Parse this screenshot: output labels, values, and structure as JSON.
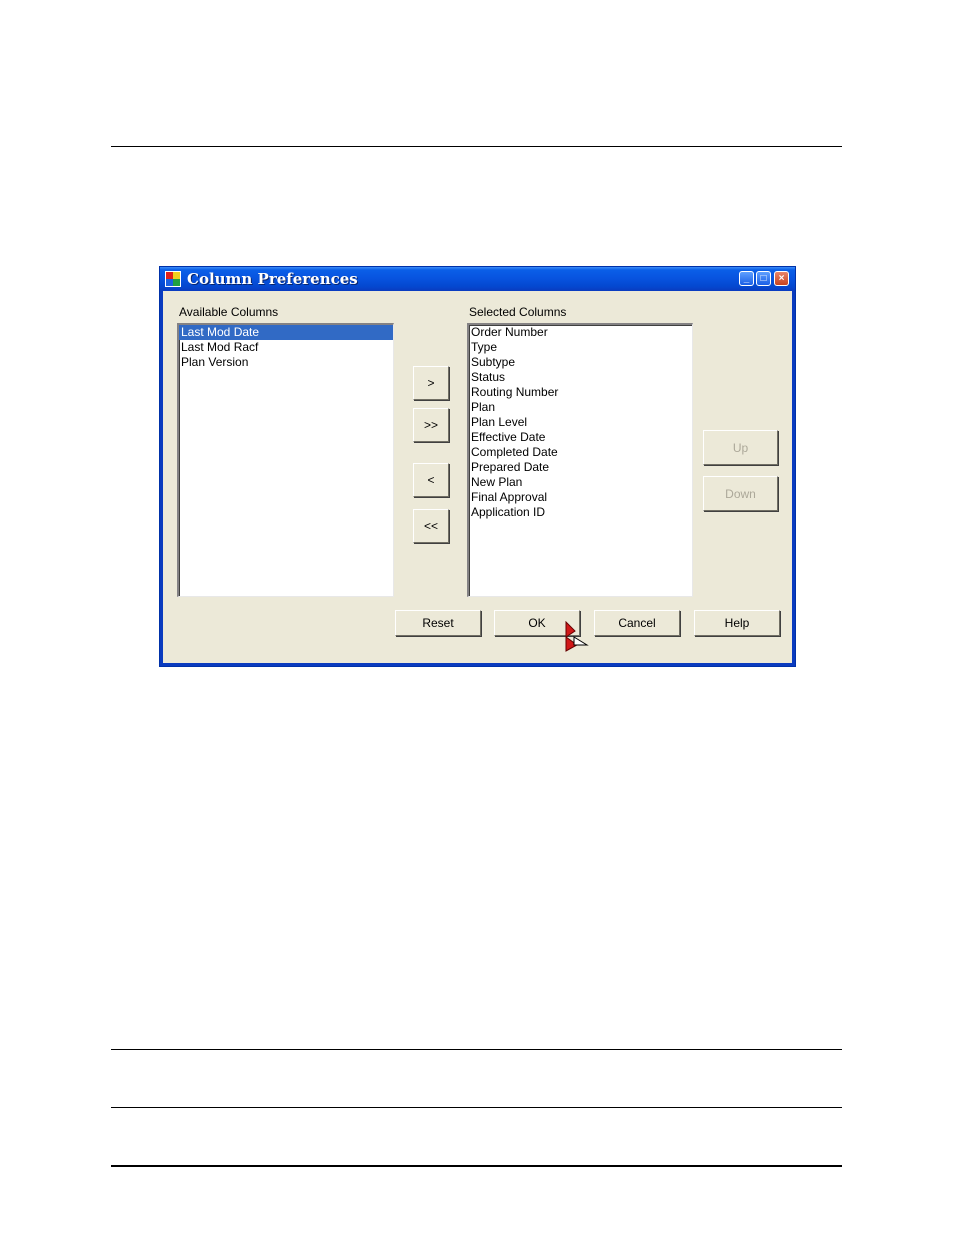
{
  "window": {
    "title": "Column Preferences",
    "controls": {
      "minimize": "_",
      "maximize": "□",
      "close": "×"
    }
  },
  "available": {
    "label": "Available Columns",
    "items": [
      "Last Mod Date",
      "Last Mod Racf",
      "Plan Version"
    ],
    "selected_index": 0
  },
  "selected": {
    "label": "Selected Columns",
    "items": [
      "Order Number",
      "Type",
      "Subtype",
      "Status",
      "Routing Number",
      "Plan",
      "Plan Level",
      "Effective Date",
      "Completed Date",
      "Prepared Date",
      "New Plan",
      "Final Approval",
      "Application ID"
    ]
  },
  "move_buttons": {
    "add": ">",
    "add_all": ">>",
    "remove": "<",
    "remove_all": "<<"
  },
  "order_buttons": {
    "up": "Up",
    "down": "Down"
  },
  "footer_buttons": {
    "reset": "Reset",
    "ok": "OK",
    "cancel": "Cancel",
    "help": "Help"
  },
  "colors": {
    "selection": "#316ac5",
    "dialog_bg": "#ece9d8",
    "title_blue": "#0854e0"
  }
}
